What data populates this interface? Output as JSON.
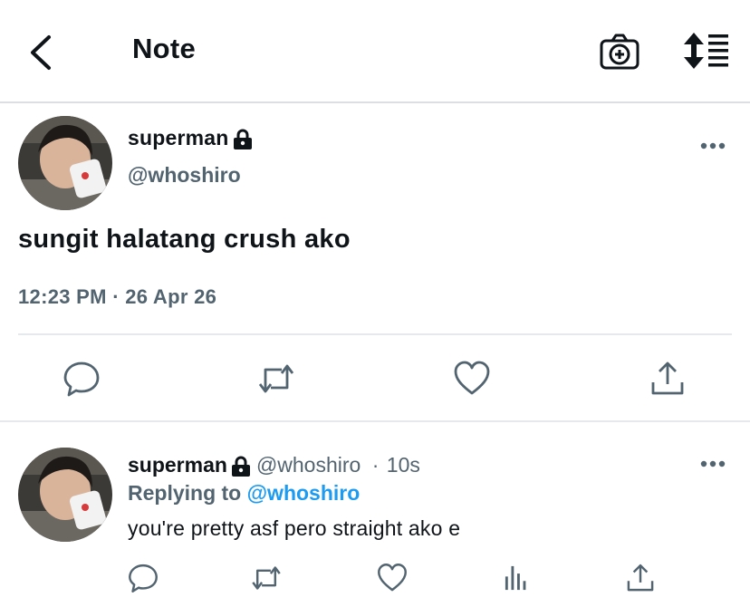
{
  "header": {
    "title": "Note"
  },
  "tweet": {
    "display_name": "superman",
    "handle": "@whoshiro",
    "text": "sungit halatang crush ako",
    "timestamp": "12:23 PM · 26 Apr 26"
  },
  "reply": {
    "display_name": "superman",
    "handle": "@whoshiro",
    "separator": "·",
    "age": "10s",
    "replying_prefix": "Replying to",
    "replying_to": "@whoshiro",
    "text": "you're pretty asf pero straight ako e"
  },
  "colors": {
    "text": "#0f1419",
    "secondary": "#536471",
    "accent": "#1d9bf0",
    "divider": "#e6e9eb"
  },
  "icons": [
    "back-icon",
    "camera-plus-icon",
    "sort-icon",
    "lock-icon",
    "more-icon",
    "reply-icon",
    "retweet-icon",
    "like-icon",
    "share-icon",
    "analytics-icon"
  ]
}
